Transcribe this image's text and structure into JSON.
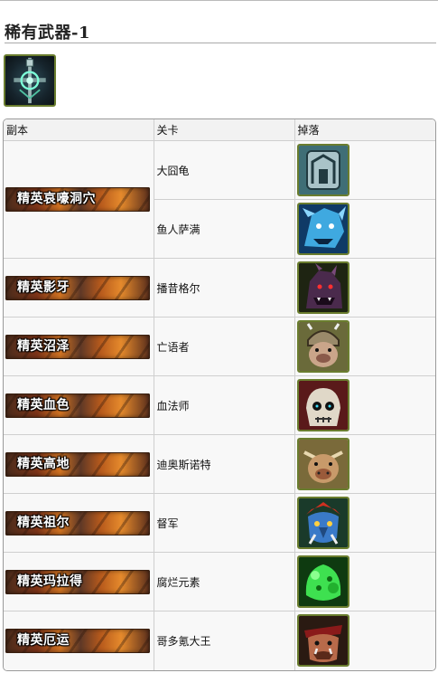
{
  "page": {
    "title": "稀有武器-1"
  },
  "item": {
    "icon": "glowing-sword-icon"
  },
  "table": {
    "headers": [
      "副本",
      "关卡",
      "掉落"
    ],
    "rows": [
      {
        "dungeon": "精英哀嚎洞穴",
        "stage": "大囧龟",
        "drop_icon": "tortoise-shell-icon"
      },
      {
        "dungeon": "",
        "stage": "鱼人萨满",
        "drop_icon": "blue-murloc-icon"
      },
      {
        "dungeon": "精英影牙",
        "stage": "播昔格尔",
        "drop_icon": "dark-worgen-icon"
      },
      {
        "dungeon": "精英沼泽",
        "stage": "亡语者",
        "drop_icon": "quilboar-deathspeaker-icon"
      },
      {
        "dungeon": "精英血色",
        "stage": "血法师",
        "drop_icon": "skull-bloodmage-icon"
      },
      {
        "dungeon": "精英高地",
        "stage": "迪奥斯诺特",
        "drop_icon": "quilboar-chief-icon"
      },
      {
        "dungeon": "精英祖尔",
        "stage": "督军",
        "drop_icon": "troll-warlord-icon"
      },
      {
        "dungeon": "精英玛拉得",
        "stage": "腐烂元素",
        "drop_icon": "green-slime-elemental-icon"
      },
      {
        "dungeon": "精英厄运",
        "stage": "哥多氪大王",
        "drop_icon": "ogre-king-icon"
      }
    ]
  }
}
